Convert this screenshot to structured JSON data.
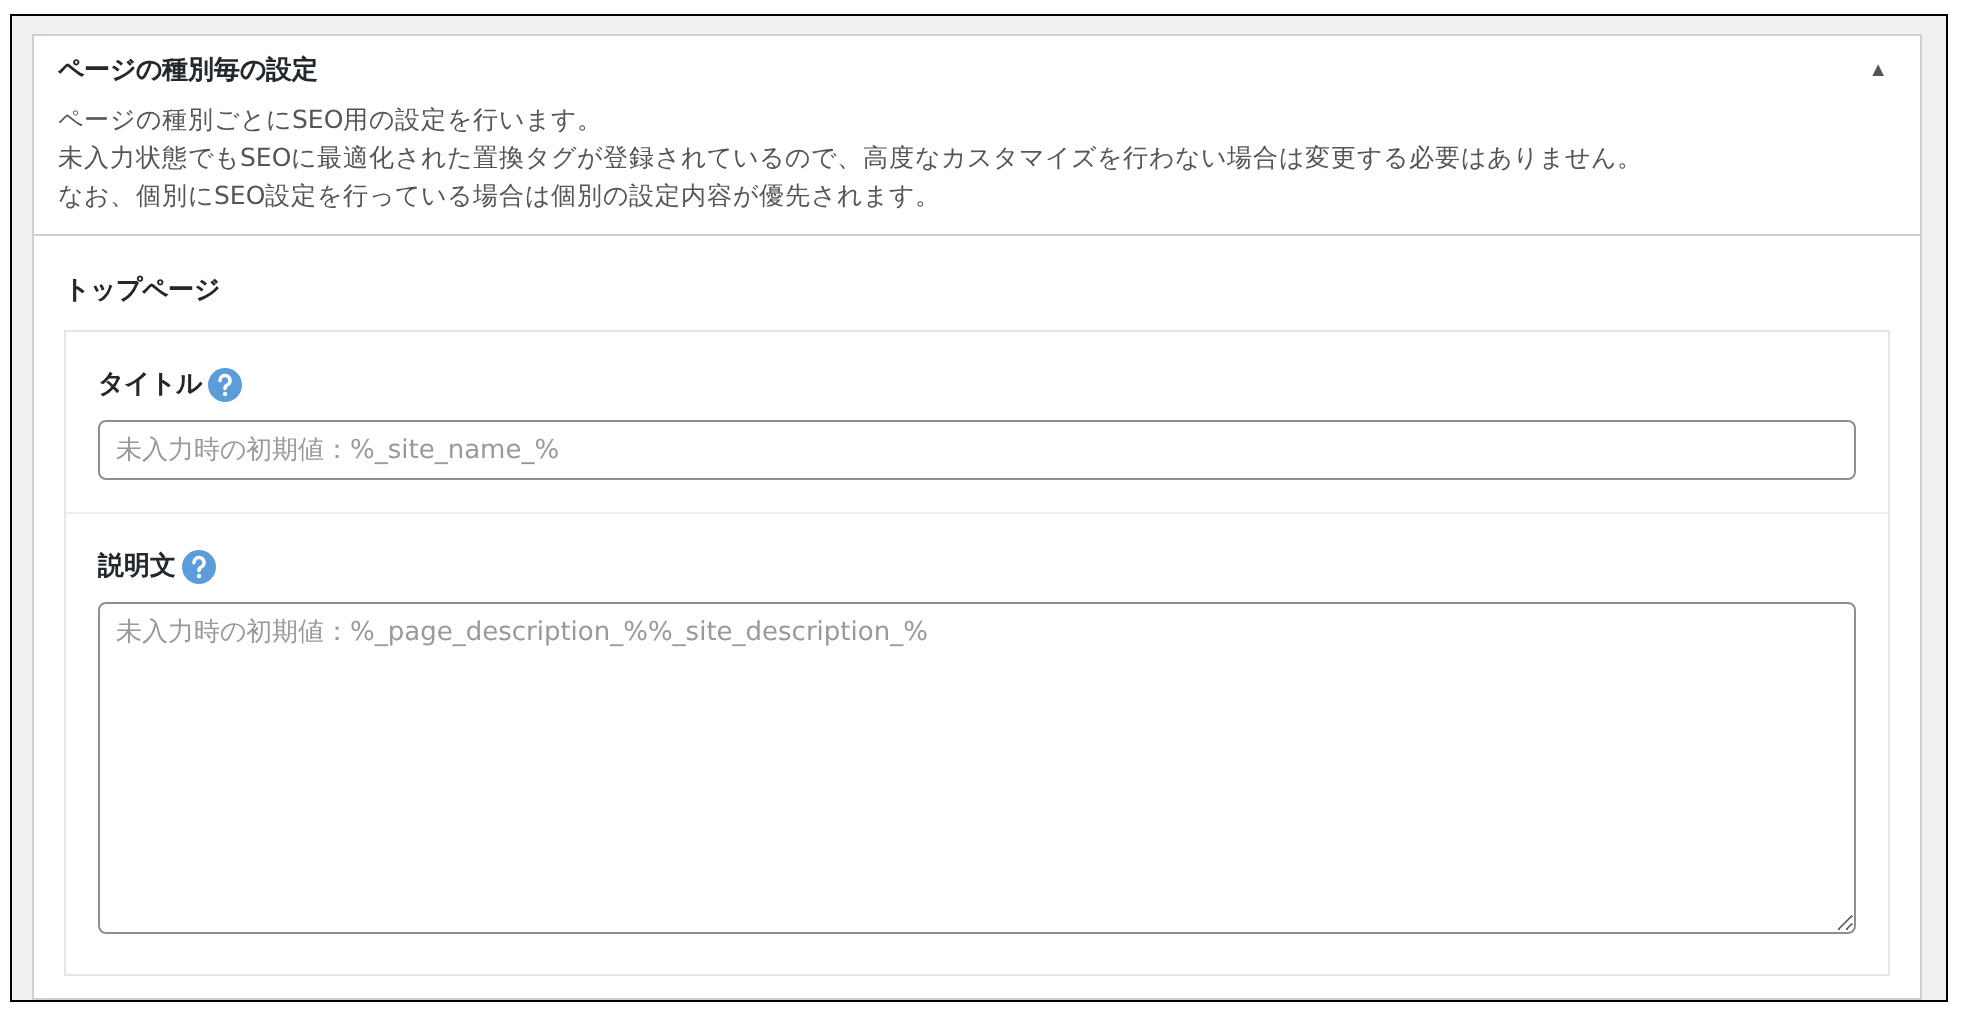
{
  "panel": {
    "title": "ページの種別毎の設定",
    "toggle": "▲",
    "description": [
      "ページの種別ごとにSEO用の設定を行います。",
      "未入力状態でもSEOに最適化された置換タグが登録されているので、高度なカスタマイズを行わない場合は変更する必要はありません。",
      "なお、個別にSEO設定を行っている場合は個別の設定内容が優先されます。"
    ]
  },
  "section": {
    "title": "トップページ",
    "fields": [
      {
        "kind": "input",
        "label": "タイトル",
        "placeholder": "未入力時の初期値：%_site_name_%"
      },
      {
        "kind": "textarea",
        "label": "説明文",
        "placeholder": "未入力時の初期値：%_page_description_%%_site_description_%"
      }
    ]
  }
}
